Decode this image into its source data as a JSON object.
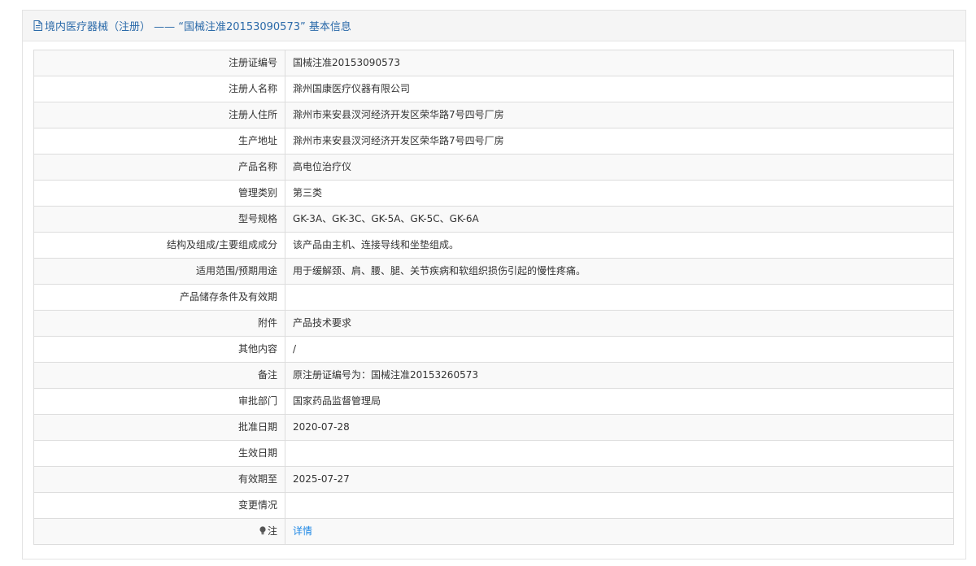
{
  "header": {
    "title": "境内医疗器械（注册） —— “国械注准20153090573” 基本信息",
    "icon": "document-icon"
  },
  "rows": [
    {
      "label": "注册证编号",
      "value": "国械注准20153090573"
    },
    {
      "label": "注册人名称",
      "value": "滁州国康医疗仪器有限公司"
    },
    {
      "label": "注册人住所",
      "value": "滁州市来安县汊河经济开发区荣华路7号四号厂房"
    },
    {
      "label": "生产地址",
      "value": "滁州市来安县汊河经济开发区荣华路7号四号厂房"
    },
    {
      "label": "产品名称",
      "value": "高电位治疗仪"
    },
    {
      "label": "管理类别",
      "value": "第三类"
    },
    {
      "label": "型号规格",
      "value": "GK-3A、GK-3C、GK-5A、GK-5C、GK-6A"
    },
    {
      "label": "结构及组成/主要组成成分",
      "value": "该产品由主机、连接导线和坐垫组成。"
    },
    {
      "label": "适用范围/预期用途",
      "value": "用于缓解颈、肩、腰、腿、关节疾病和软组织损伤引起的慢性疼痛。"
    },
    {
      "label": "产品储存条件及有效期",
      "value": ""
    },
    {
      "label": "附件",
      "value": "产品技术要求"
    },
    {
      "label": "其他内容",
      "value": "/"
    },
    {
      "label": "备注",
      "value": "原注册证编号为：国械注准20153260573"
    },
    {
      "label": "审批部门",
      "value": "国家药品监督管理局"
    },
    {
      "label": "批准日期",
      "value": "2020-07-28"
    },
    {
      "label": "生效日期",
      "value": ""
    },
    {
      "label": "有效期至",
      "value": "2025-07-27"
    },
    {
      "label": "变更情况",
      "value": ""
    }
  ],
  "note_row": {
    "label": "注",
    "icon": "lightbulb-icon",
    "link_text": "详情"
  },
  "colors": {
    "header_text": "#2b6aa9",
    "link": "#1e88e5",
    "stripe": "#f9f9f9",
    "border": "#dddddd"
  }
}
